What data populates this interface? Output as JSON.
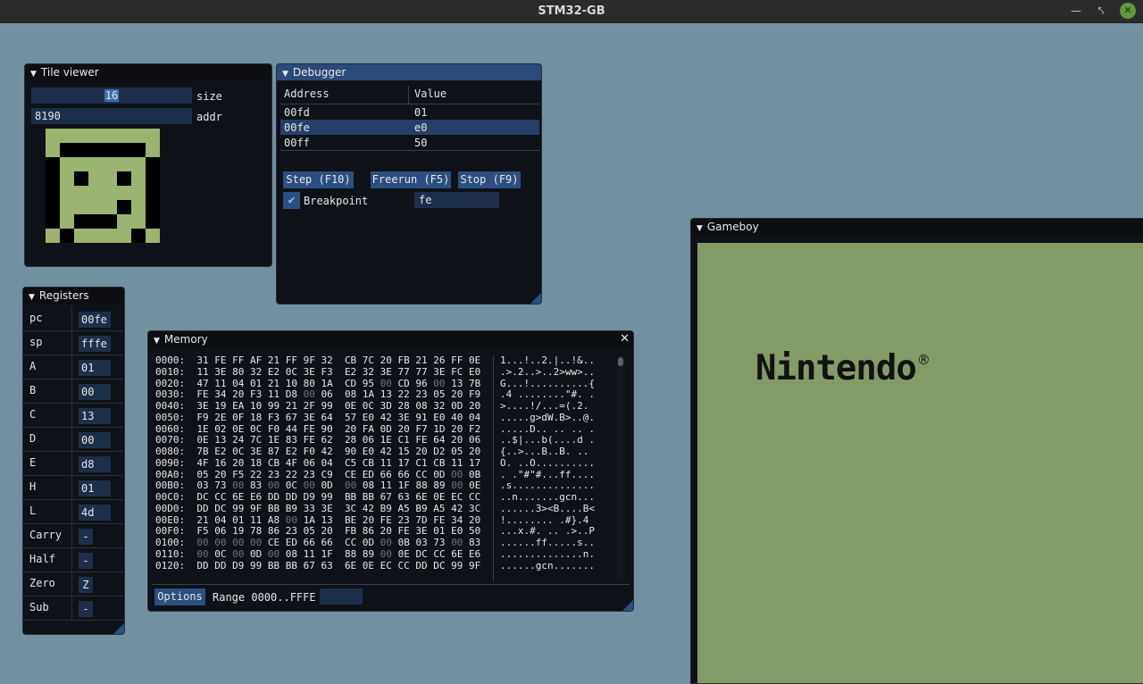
{
  "app": {
    "title": "STM32-GB"
  },
  "tile_viewer": {
    "title": "Tile viewer",
    "size_value": "16",
    "size_label": "size",
    "addr_value": "8190",
    "addr_label": "addr",
    "pixel_rows": [
      "00000000",
      "01111110",
      "10000001",
      "10100101",
      "10000001",
      "10000101",
      "10111001",
      "01000010"
    ]
  },
  "debugger": {
    "title": "Debugger",
    "columns": [
      "Address",
      "Value"
    ],
    "rows": [
      {
        "address": "00fd",
        "value": "01"
      },
      {
        "address": "00fe",
        "value": "e0"
      },
      {
        "address": "00ff",
        "value": "50"
      }
    ],
    "step_label": "Step (F10)",
    "freerun_label": "Freerun (F5)",
    "stop_label": "Stop (F9)",
    "breakpoint_label": "Breakpoint",
    "breakpoint_value": "fe"
  },
  "registers": {
    "title": "Registers",
    "items": [
      {
        "name": "pc",
        "value": "00fe"
      },
      {
        "name": "sp",
        "value": "fffe"
      },
      {
        "name": "A",
        "value": "01"
      },
      {
        "name": "B",
        "value": "00"
      },
      {
        "name": "C",
        "value": "13"
      },
      {
        "name": "D",
        "value": "00"
      },
      {
        "name": "E",
        "value": "d8"
      },
      {
        "name": "H",
        "value": "01"
      },
      {
        "name": "L",
        "value": "4d"
      },
      {
        "name": "Carry",
        "value": "-"
      },
      {
        "name": "Half",
        "value": "-"
      },
      {
        "name": "Zero",
        "value": "Z"
      },
      {
        "name": "Sub",
        "value": "-"
      }
    ]
  },
  "memory": {
    "title": "Memory",
    "close_icon": "close-icon",
    "options_label": "Options",
    "range_label": "Range 0000..FFFE",
    "rows": [
      {
        "addr": "0000:",
        "hex": "31 FE FF AF 21 FF 9F 32  CB 7C 20 FB 21 26 FF 0E",
        "ascii": "1...!..2.|..!&.."
      },
      {
        "addr": "0010:",
        "hex": "11 3E 80 32 E2 0C 3E F3  E2 32 3E 77 77 3E FC E0",
        "ascii": ".>.2..>..2>ww>.."
      },
      {
        "addr": "0020:",
        "hex": "47 11 04 01 21 10 80 1A  CD 95 00 CD 96 00 13 7B",
        "ascii": "G...!..........{"
      },
      {
        "addr": "0030:",
        "hex": "FE 34 20 F3 11 D8 00 06  08 1A 13 22 23 05 20 F9",
        "ascii": ".4 ........\"#. ."
      },
      {
        "addr": "0040:",
        "hex": "3E 19 EA 10 99 21 2F 99  0E 0C 3D 28 08 32 0D 20",
        "ascii": ">....!/...=(.2. "
      },
      {
        "addr": "0050:",
        "hex": "F9 2E 0F 18 F3 67 3E 64  57 E0 42 3E 91 E0 40 04",
        "ascii": ".....g>dW.B>..@."
      },
      {
        "addr": "0060:",
        "hex": "1E 02 0E 0C F0 44 FE 90  20 FA 0D 20 F7 1D 20 F2",
        "ascii": ".....D.. .. .. ."
      },
      {
        "addr": "0070:",
        "hex": "0E 13 24 7C 1E 83 FE 62  28 06 1E C1 FE 64 20 06",
        "ascii": "..$|...b(....d ."
      },
      {
        "addr": "0080:",
        "hex": "7B E2 0C 3E 87 E2 F0 42  90 E0 42 15 20 D2 05 20",
        "ascii": "{..>...B..B. .. "
      },
      {
        "addr": "0090:",
        "hex": "4F 16 20 18 CB 4F 06 04  C5 CB 11 17 C1 CB 11 17",
        "ascii": "O. ..O.........."
      },
      {
        "addr": "00A0:",
        "hex": "05 20 F5 22 23 22 23 C9  CE ED 66 66 CC 0D 00 0B",
        "ascii": ". .\"#\"#...ff...."
      },
      {
        "addr": "00B0:",
        "hex": "03 73 00 83 00 0C 00 0D  00 08 11 1F 88 89 00 0E",
        "ascii": ".s.............."
      },
      {
        "addr": "00C0:",
        "hex": "DC CC 6E E6 DD DD D9 99  BB BB 67 63 6E 0E EC CC",
        "ascii": "..n.......gcn..."
      },
      {
        "addr": "00D0:",
        "hex": "DD DC 99 9F BB B9 33 3E  3C 42 B9 A5 B9 A5 42 3C",
        "ascii": "......3><B....B<"
      },
      {
        "addr": "00E0:",
        "hex": "21 04 01 11 A8 00 1A 13  BE 20 FE 23 7D FE 34 20",
        "ascii": "!........ .#}.4 "
      },
      {
        "addr": "00F0:",
        "hex": "F5 06 19 78 86 23 05 20  FB 86 20 FE 3E 01 E0 50",
        "ascii": "...x.#. .. .>..P"
      },
      {
        "addr": "0100:",
        "hex": "00 00 00 00 CE ED 66 66  CC 0D 00 0B 03 73 00 83",
        "ascii": "......ff.....s.."
      },
      {
        "addr": "0110:",
        "hex": "00 0C 00 0D 00 08 11 1F  88 89 00 0E DC CC 6E E6",
        "ascii": "..............n."
      },
      {
        "addr": "0120:",
        "hex": "DD DD D9 99 BB BB 67 63  6E 0E EC CC DD DC 99 9F",
        "ascii": "......gcn......."
      }
    ]
  },
  "gameboy": {
    "title": "Gameboy",
    "logo_text": "Nintendo",
    "registered_mark": "®",
    "screen_color": "#839b66"
  }
}
